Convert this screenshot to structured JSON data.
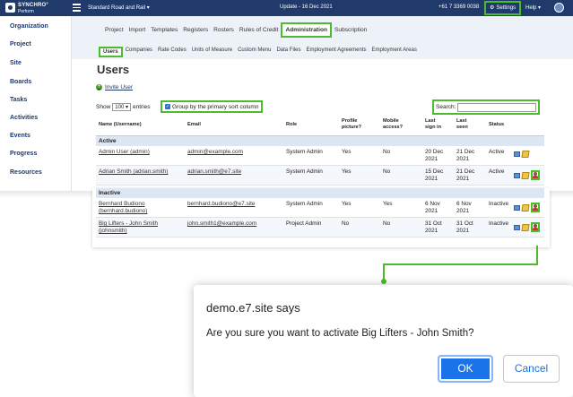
{
  "topbar": {
    "logo_line1": "SYNCHRO°",
    "logo_line2": "Perform",
    "project": "Standard Road and Rail ▾",
    "update": "Update - 16 Dec 2021",
    "phone": "+61 7 3369 0038",
    "settings": "Settings",
    "help": "Help ▾"
  },
  "sidebar": {
    "items": [
      "Organization",
      "Project",
      "Site",
      "Boards",
      "Tasks",
      "Activities",
      "Events",
      "Progress",
      "Resources"
    ]
  },
  "nav": {
    "main_tabs": [
      "Project",
      "Import",
      "Templates",
      "Registers",
      "Rosters",
      "Rules of Credit",
      "Administration",
      "Subscription"
    ],
    "sub_tabs": [
      "Users",
      "Companies",
      "Rate Codes",
      "Units of Measure",
      "Custom Menu",
      "Data Files",
      "Employment Agreements",
      "Employment Areas"
    ]
  },
  "content": {
    "title": "Users",
    "invite": "Invite User",
    "show": "Show",
    "entries_value": "100 ▾",
    "entries": "entries",
    "group_label": "Group by the primary sort column",
    "search_label": "Search:"
  },
  "table": {
    "headers": {
      "name": "Name (Username)",
      "email": "Email",
      "role": "Role",
      "profile": "Profile picture?",
      "mobile": "Mobile access?",
      "last_sign": "Last sign in",
      "last_seen": "Last seen",
      "status": "Status"
    },
    "groups": [
      "Active",
      "Inactive"
    ],
    "rows": [
      {
        "name": "Admin User (admin)",
        "email": "admin@example.com",
        "role": "System Admin",
        "profile": "Yes",
        "mobile": "No",
        "last_sign": "20 Dec 2021",
        "last_seen": "21 Dec 2021",
        "status": "Active"
      },
      {
        "name": "Adrian Smith (adrian.smith)",
        "email": "adrian.smith@e7.site",
        "role": "System Admin",
        "profile": "Yes",
        "mobile": "No",
        "last_sign": "15 Dec 2021",
        "last_seen": "21 Dec 2021",
        "status": "Active"
      },
      {
        "name": "Bernhard Budiono (bernhard.budiono)",
        "email": "bernhard.budiono@e7.site",
        "role": "System Admin",
        "profile": "Yes",
        "mobile": "Yes",
        "last_sign": "6 Nov 2021",
        "last_seen": "6 Nov 2021",
        "status": "Inactive"
      },
      {
        "name": "Big Lifters - John Smith (johnsmith)",
        "email": "john.smith1@example.com",
        "role": "Project Admin",
        "profile": "No",
        "mobile": "No",
        "last_sign": "31 Oct 2021",
        "last_seen": "31 Oct 2021",
        "status": "Inactive"
      }
    ]
  },
  "dialog": {
    "title": "demo.e7.site says",
    "message": "Are you sure you want to activate Big Lifters - John Smith?",
    "ok": "OK",
    "cancel": "Cancel"
  },
  "colors": {
    "highlight": "#4cbb2f",
    "topbar": "#1f3a6b",
    "dialog_primary": "#1a73e8"
  }
}
